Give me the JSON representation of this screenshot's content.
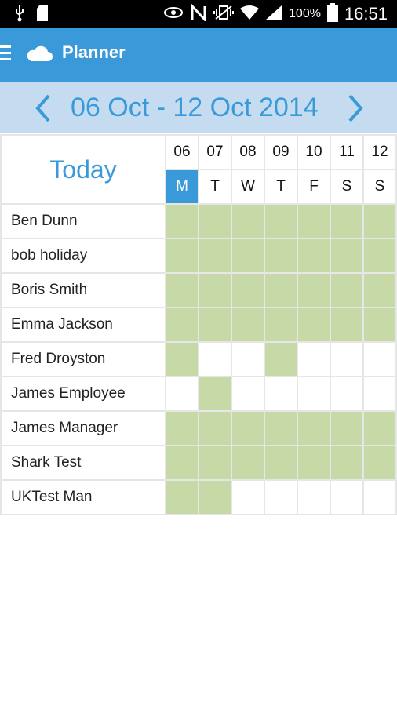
{
  "status_bar": {
    "battery_percent": "100%",
    "time": "16:51",
    "icons_left": [
      "usb-icon",
      "sd-card-icon"
    ],
    "icons_right": [
      "eye-icon",
      "nfc-icon",
      "vibrate-icon",
      "wifi-icon",
      "signal-icon",
      "battery-icon"
    ]
  },
  "app_bar": {
    "title": "Planner",
    "icons": [
      "menu-icon",
      "cloud-icon"
    ]
  },
  "week_nav": {
    "label": "06 Oct  - 12 Oct 2014"
  },
  "grid": {
    "today_label": "Today",
    "days": [
      {
        "num": "06",
        "letter": "M",
        "active": true
      },
      {
        "num": "07",
        "letter": "T",
        "active": false
      },
      {
        "num": "08",
        "letter": "W",
        "active": false
      },
      {
        "num": "09",
        "letter": "T",
        "active": false
      },
      {
        "num": "10",
        "letter": "F",
        "active": false
      },
      {
        "num": "11",
        "letter": "S",
        "active": false
      },
      {
        "num": "12",
        "letter": "S",
        "active": false
      }
    ],
    "rows": [
      {
        "name": "Ben Dunn",
        "busy": [
          1,
          1,
          1,
          1,
          1,
          1,
          1
        ]
      },
      {
        "name": "bob holiday",
        "busy": [
          1,
          1,
          1,
          1,
          1,
          1,
          1
        ]
      },
      {
        "name": "Boris Smith",
        "busy": [
          1,
          1,
          1,
          1,
          1,
          1,
          1
        ]
      },
      {
        "name": "Emma Jackson",
        "busy": [
          1,
          1,
          1,
          1,
          1,
          1,
          1
        ]
      },
      {
        "name": "Fred Droyston",
        "busy": [
          1,
          0,
          0,
          1,
          0,
          0,
          0
        ]
      },
      {
        "name": "James Employee",
        "busy": [
          0,
          1,
          0,
          0,
          0,
          0,
          0
        ]
      },
      {
        "name": "James Manager",
        "busy": [
          1,
          1,
          1,
          1,
          1,
          1,
          1
        ]
      },
      {
        "name": "Shark Test",
        "busy": [
          1,
          1,
          1,
          1,
          1,
          1,
          1
        ]
      },
      {
        "name": "UKTest Man",
        "busy": [
          1,
          1,
          0,
          0,
          0,
          0,
          0
        ]
      }
    ],
    "colors": {
      "busy": "#c6d9a6",
      "free": "#ffffff",
      "accent": "#3a9ad9",
      "grid_line": "#e6e6e6"
    }
  }
}
